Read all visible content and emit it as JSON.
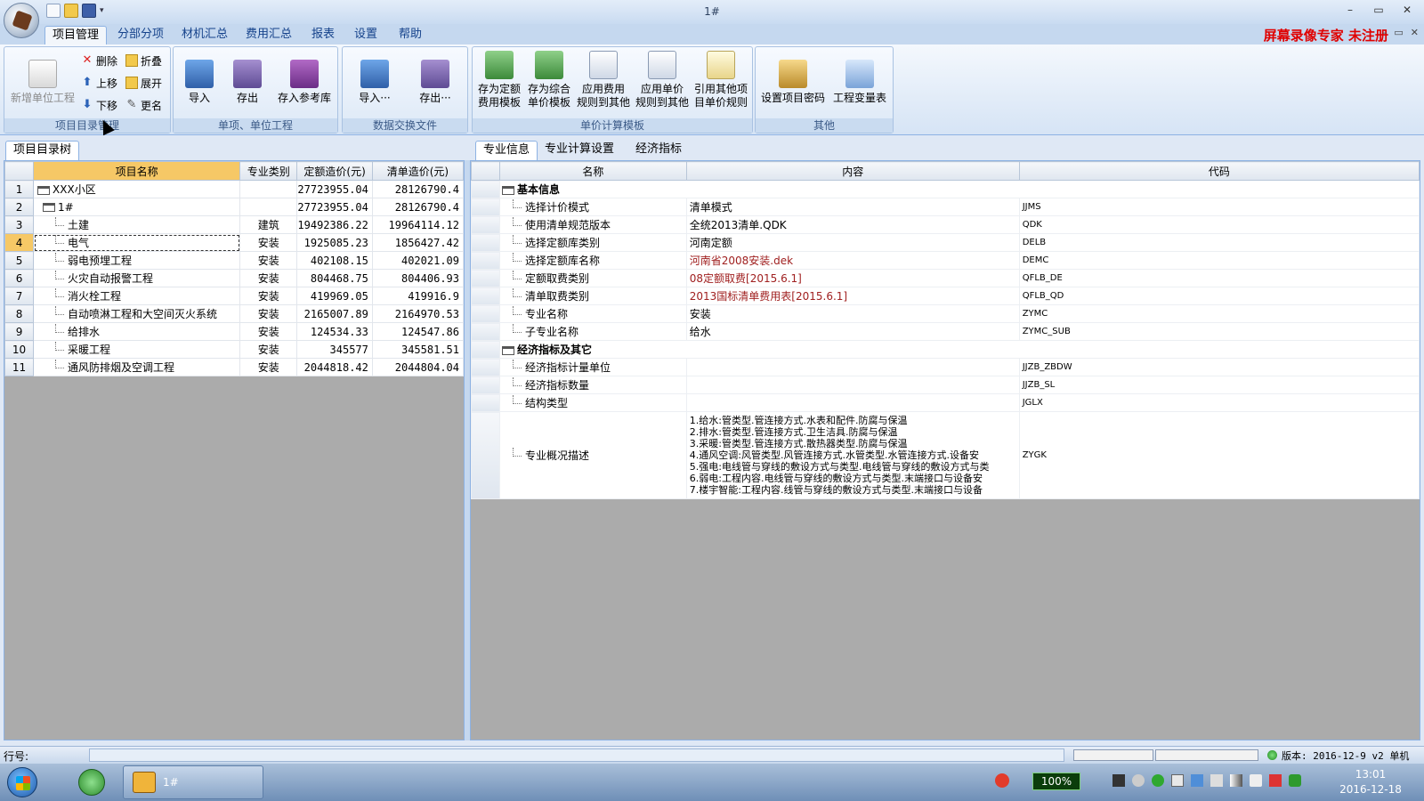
{
  "window": {
    "title": "1#",
    "minimize": "–",
    "maximize": "▭",
    "close": "✕"
  },
  "ribbon_tabs": [
    "项目管理",
    "分部分项",
    "材机汇总",
    "费用汇总",
    "报表",
    "设置",
    "帮助"
  ],
  "watermark": "屏幕录像专家 未注册",
  "mdi_controls": [
    "–",
    "▭",
    "✕"
  ],
  "ribbon": {
    "groups": [
      {
        "label": "项目目录管理"
      },
      {
        "label": "单项、单位工程"
      },
      {
        "label": "数据交换文件"
      },
      {
        "label": "单价计算模板"
      },
      {
        "label": "其他"
      }
    ],
    "new_unit": "新增单位工程",
    "delete": "删除",
    "move_up": "上移",
    "move_down": "下移",
    "fold": "折叠",
    "expand": "展开",
    "rename": "更名",
    "import": "导入",
    "export": "存出",
    "save_ref": "存入参考库",
    "import_more": "导入···",
    "export_more": "存出···",
    "save_quota_tpl_1": "存为定额",
    "save_quota_tpl_2": "费用模板",
    "save_unit_tpl_1": "存为综合",
    "save_unit_tpl_2": "单价模板",
    "apply_fee_1": "应用费用",
    "apply_fee_2": "规则到其他",
    "apply_price_1": "应用单价",
    "apply_price_2": "规则到其他",
    "ref_rule_1": "引用其他项",
    "ref_rule_2": "目单价规则",
    "set_password": "设置项目密码",
    "change_table": "工程变量表"
  },
  "left_panel": {
    "tab": "项目目录树",
    "columns": [
      "项目名称",
      "专业类别",
      "定额造价(元)",
      "清单造价(元)"
    ],
    "rows": [
      {
        "n": "1",
        "name": "XXX小区",
        "cat": "",
        "quota": "27723955.04",
        "list": "28126790.4",
        "level": 0
      },
      {
        "n": "2",
        "name": "1#",
        "cat": "",
        "quota": "27723955.04",
        "list": "28126790.4",
        "level": 1
      },
      {
        "n": "3",
        "name": "土建",
        "cat": "建筑",
        "quota": "19492386.22",
        "list": "19964114.12",
        "level": 2
      },
      {
        "n": "4",
        "name": "电气",
        "cat": "安装",
        "quota": "1925085.23",
        "list": "1856427.42",
        "level": 2
      },
      {
        "n": "5",
        "name": "弱电预埋工程",
        "cat": "安装",
        "quota": "402108.15",
        "list": "402021.09",
        "level": 2
      },
      {
        "n": "6",
        "name": "火灾自动报警工程",
        "cat": "安装",
        "quota": "804468.75",
        "list": "804406.93",
        "level": 2
      },
      {
        "n": "7",
        "name": "消火栓工程",
        "cat": "安装",
        "quota": "419969.05",
        "list": "419916.9",
        "level": 2
      },
      {
        "n": "8",
        "name": "自动喷淋工程和大空间灭火系统",
        "cat": "安装",
        "quota": "2165007.89",
        "list": "2164970.53",
        "level": 2
      },
      {
        "n": "9",
        "name": "给排水",
        "cat": "安装",
        "quota": "124534.33",
        "list": "124547.86",
        "level": 2
      },
      {
        "n": "10",
        "name": "采暖工程",
        "cat": "安装",
        "quota": "345577",
        "list": "345581.51",
        "level": 2
      },
      {
        "n": "11",
        "name": "通风防排烟及空调工程",
        "cat": "安装",
        "quota": "2044818.42",
        "list": "2044804.04",
        "level": 2
      }
    ]
  },
  "right_panel": {
    "tabs": [
      "专业信息",
      "专业计算设置",
      "经济指标"
    ],
    "columns": [
      "名称",
      "内容",
      "代码"
    ],
    "section_basic": "基本信息",
    "section_econ": "经济指标及其它",
    "basic_rows": [
      {
        "name": "选择计价模式",
        "content": "清单模式",
        "code": "JJMS",
        "red": false
      },
      {
        "name": "使用清单规范版本",
        "content": "全统2013清单.QDK",
        "code": "QDK",
        "red": false
      },
      {
        "name": "选择定额库类别",
        "content": "河南定额",
        "code": "DELB",
        "red": false
      },
      {
        "name": "选择定额库名称",
        "content": "河南省2008安装.dek",
        "code": "DEMC",
        "red": true
      },
      {
        "name": "定额取费类别",
        "content": "08定额取费[2015.6.1]",
        "code": "QFLB_DE",
        "red": true
      },
      {
        "name": "清单取费类别",
        "content": "2013国标清单费用表[2015.6.1]",
        "code": "QFLB_QD",
        "red": true
      },
      {
        "name": "专业名称",
        "content": "安装",
        "code": "ZYMC",
        "red": false
      },
      {
        "name": "子专业名称",
        "content": "给水",
        "code": "ZYMC_SUB",
        "red": false
      }
    ],
    "econ_rows": [
      {
        "name": "经济指标计量单位",
        "content": "",
        "code": "JJZB_ZBDW"
      },
      {
        "name": "经济指标数量",
        "content": "",
        "code": "JJZB_SL"
      },
      {
        "name": "结构类型",
        "content": "",
        "code": "JGLX"
      }
    ],
    "desc_row": {
      "name": "专业概况描述",
      "code": "ZYGK",
      "lines": [
        "1.给水:管类型.管连接方式.水表和配件.防腐与保温",
        "2.排水:管类型.管连接方式.卫生洁具.防腐与保温",
        "3.采暖:管类型.管连接方式.散热器类型.防腐与保温",
        "4.通风空调:风管类型.风管连接方式.水管类型.水管连接方式.设备安",
        "5.强电:电线管与穿线的敷设方式与类型.电线管与穿线的敷设方式与类",
        "6.弱电:工程内容.电线管与穿线的敷设方式与类型.末端接口与设备安",
        "7.楼宇智能:工程内容.线管与穿线的敷设方式与类型.末端接口与设备"
      ]
    }
  },
  "statusbar": {
    "row_label": "行号:",
    "version": "版本: 2016-12-9 v2 单机"
  },
  "taskbar": {
    "task_label": "1#",
    "battery": "100%",
    "time": "13:01",
    "date": "2016-12-18"
  }
}
